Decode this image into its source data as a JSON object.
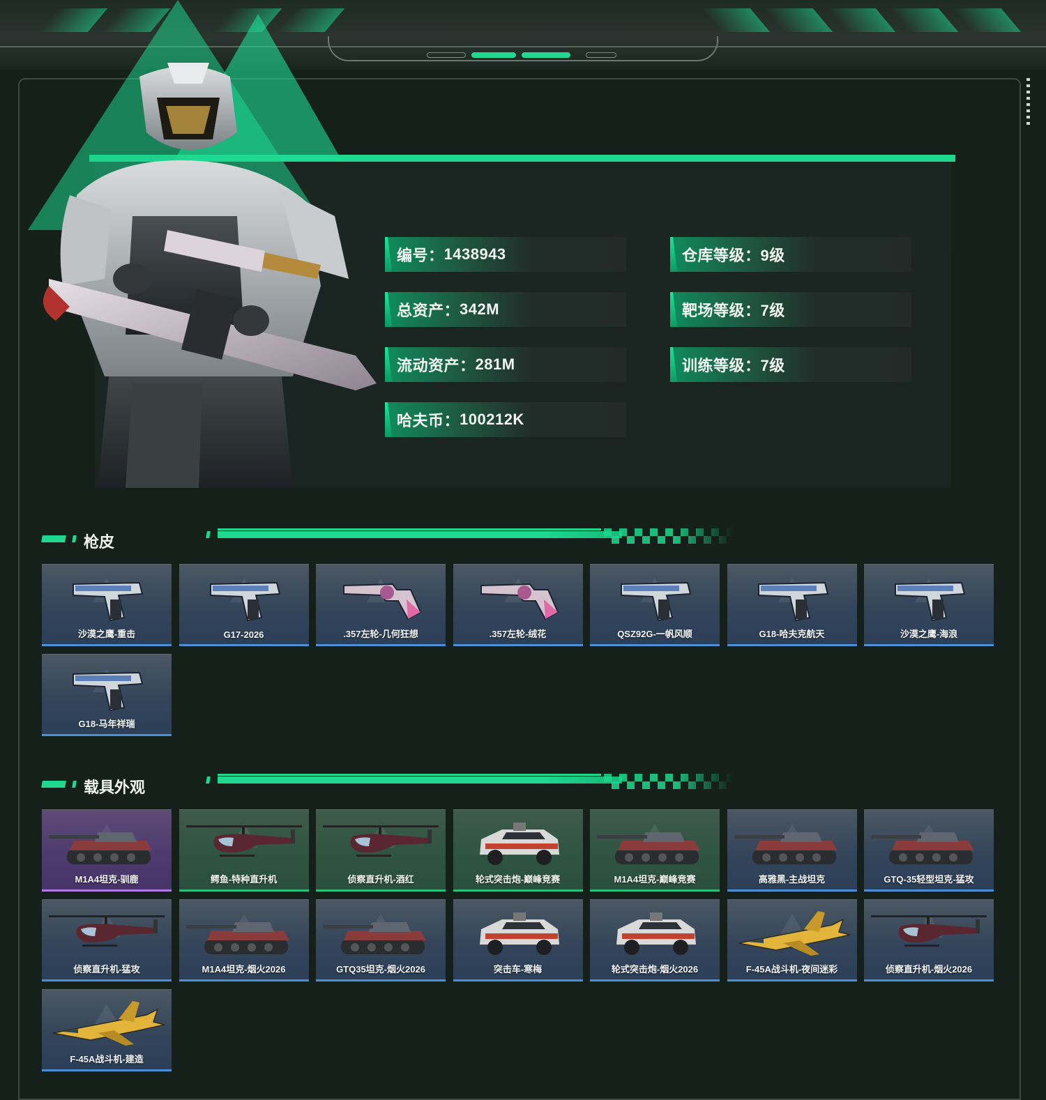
{
  "profile": {
    "stats_left": [
      {
        "label": "编号：",
        "value": "1438943"
      },
      {
        "label": "总资产：",
        "value": "342M"
      },
      {
        "label": "流动资产：",
        "value": "281M"
      },
      {
        "label": "哈夫币：",
        "value": "100212K"
      }
    ],
    "stats_right": [
      {
        "label": "仓库等级：",
        "value": "9级"
      },
      {
        "label": "靶场等级：",
        "value": "7级"
      },
      {
        "label": "训练等级：",
        "value": "7级"
      }
    ]
  },
  "gun_skins": {
    "title": "枪皮",
    "items": [
      {
        "name": "沙漠之鹰-重击",
        "icon": "pistol-icon",
        "accent": "#4a8fd8"
      },
      {
        "name": "G17-2026",
        "icon": "pistol-icon",
        "accent": "#4a8fd8"
      },
      {
        "name": ".357左轮-几何狂想",
        "icon": "revolver-icon",
        "accent": "#4a8fd8"
      },
      {
        "name": ".357左轮-绒花",
        "icon": "revolver-icon",
        "accent": "#4a8fd8"
      },
      {
        "name": "QSZ92G-一帆风顺",
        "icon": "pistol-icon",
        "accent": "#4a8fd8"
      },
      {
        "name": "G18-哈夫克航天",
        "icon": "pistol-icon",
        "accent": "#4a8fd8"
      },
      {
        "name": "沙漠之鹰-海浪",
        "icon": "pistol-icon",
        "accent": "#4a8fd8"
      },
      {
        "name": "G18-马年祥瑞",
        "icon": "pistol-icon",
        "accent": "#4a8fd8"
      }
    ]
  },
  "vehicle_skins": {
    "title": "载具外观",
    "items": [
      {
        "name": "M1A4坦克-驯鹿",
        "icon": "tank-icon",
        "rarity": "purple"
      },
      {
        "name": "鳄鱼-特种直升机",
        "icon": "helicopter-icon",
        "rarity": "green"
      },
      {
        "name": "侦察直升机-酒红",
        "icon": "helicopter-icon",
        "rarity": "green"
      },
      {
        "name": "轮式突击炮-巅峰竞赛",
        "icon": "armored-car-icon",
        "rarity": "green"
      },
      {
        "name": "M1A4坦克-巅峰竞赛",
        "icon": "tank-icon",
        "rarity": "green"
      },
      {
        "name": "高雅黑-主战坦克",
        "icon": "tank-icon",
        "rarity": "blue"
      },
      {
        "name": "GTQ-35轻型坦克-猛攻",
        "icon": "tank-icon",
        "rarity": "blue"
      },
      {
        "name": "侦察直升机-猛攻",
        "icon": "helicopter-icon",
        "rarity": "blue"
      },
      {
        "name": "M1A4坦克-烟火2026",
        "icon": "tank-icon",
        "rarity": "blue"
      },
      {
        "name": "GTQ35坦克-烟火2026",
        "icon": "tank-icon",
        "rarity": "blue"
      },
      {
        "name": "突击车-寒梅",
        "icon": "armored-car-icon",
        "rarity": "blue"
      },
      {
        "name": "轮式突击炮-烟火2026",
        "icon": "armored-car-icon",
        "rarity": "blue"
      },
      {
        "name": "F-45A战斗机-夜间迷彩",
        "icon": "jet-icon",
        "rarity": "blue"
      },
      {
        "name": "侦察直升机-烟火2026",
        "icon": "helicopter-icon",
        "rarity": "blue"
      },
      {
        "name": "F-45A战斗机-建造",
        "icon": "jet-icon",
        "rarity": "blue"
      }
    ]
  },
  "colors": {
    "accent": "#1ed88f",
    "background": "#15201b",
    "rarity_blue": "#4a8fd8",
    "rarity_green": "#29c07a",
    "rarity_purple": "#b07ae8"
  }
}
